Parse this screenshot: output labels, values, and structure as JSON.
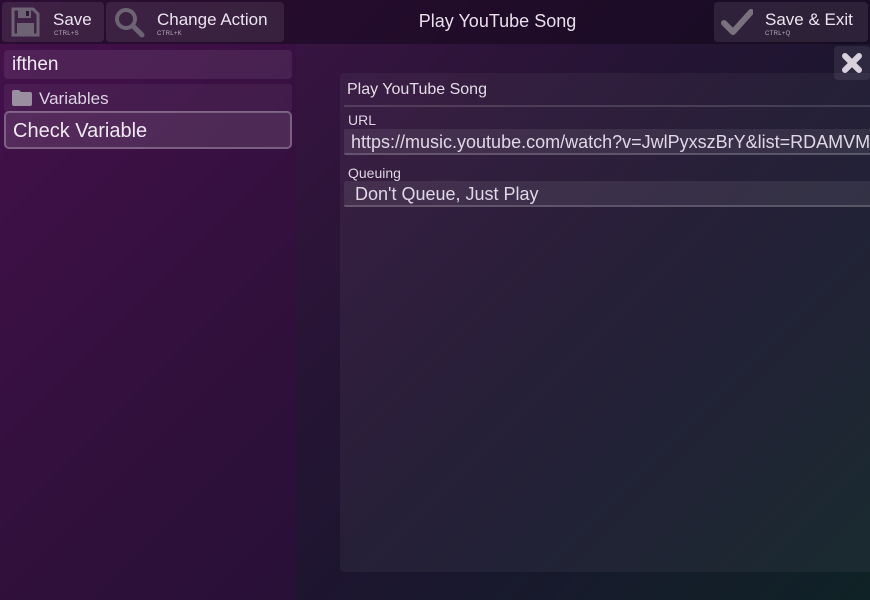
{
  "toolbar": {
    "save_label": "Save",
    "save_shortcut": "CTRL+S",
    "change_label": "Change Action",
    "change_shortcut": "CTRL+K",
    "exit_label": "Save & Exit",
    "exit_shortcut": "CTRL+Q",
    "title": "Play YouTube Song"
  },
  "sidebar": {
    "search_value": "ifthen",
    "folder_label": "Variables",
    "items": [
      {
        "label": "Check Variable"
      }
    ]
  },
  "panel": {
    "title": "Play YouTube Song",
    "fields": [
      {
        "label": "URL",
        "value": "https://music.youtube.com/watch?v=JwlPyxszBrY&list=RDAMVM"
      },
      {
        "label": "Queuing",
        "value": "Don't Queue, Just Play"
      }
    ]
  },
  "icons": {
    "save": "floppy-disk-icon",
    "change": "magnifier-icon",
    "exit": "checkmark-icon",
    "folder": "folder-icon",
    "close": "close-x-icon"
  }
}
